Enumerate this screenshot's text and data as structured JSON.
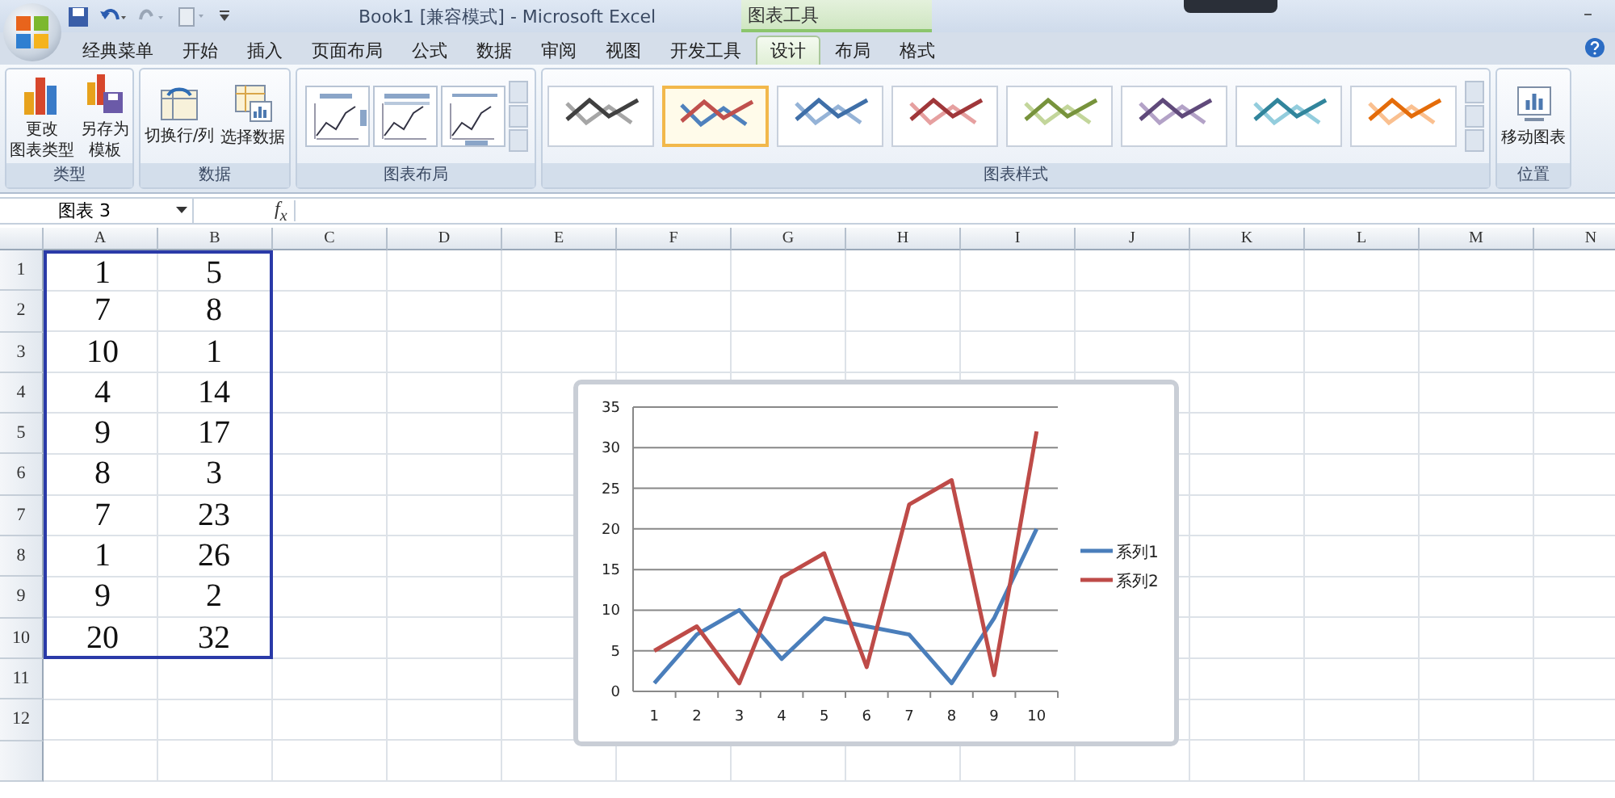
{
  "title_bar": {
    "title": "Book1  [兼容模式] - Microsoft Excel",
    "context_group": "图表工具",
    "minimize": "–"
  },
  "ribbon_tabs": [
    {
      "label": "经典菜单",
      "selected": false
    },
    {
      "label": "开始",
      "selected": false
    },
    {
      "label": "插入",
      "selected": false
    },
    {
      "label": "页面布局",
      "selected": false
    },
    {
      "label": "公式",
      "selected": false
    },
    {
      "label": "数据",
      "selected": false
    },
    {
      "label": "审阅",
      "selected": false
    },
    {
      "label": "视图",
      "selected": false
    },
    {
      "label": "开发工具",
      "selected": false
    },
    {
      "label": "设计",
      "selected": true
    },
    {
      "label": "布局",
      "selected": false
    },
    {
      "label": "格式",
      "selected": false
    }
  ],
  "ribbon_groups": [
    {
      "kind": "buttons",
      "label": "类型",
      "buttons": [
        {
          "lines": [
            "更改",
            "图表类型"
          ]
        },
        {
          "lines": [
            "另存为",
            "模板"
          ]
        }
      ]
    },
    {
      "kind": "buttons",
      "label": "数据",
      "buttons": [
        {
          "lines": [
            "切换行/列"
          ]
        },
        {
          "lines": [
            "选择数据"
          ]
        }
      ]
    },
    {
      "kind": "layouts",
      "label": "图表布局",
      "layouts": [
        {
          "kind": "legend-right"
        },
        {
          "kind": "title-top"
        },
        {
          "kind": "axis-titles"
        }
      ]
    },
    {
      "kind": "styles",
      "label": "图表样式",
      "styles": [
        {
          "lines": [
            {
              "color": "#404040"
            },
            {
              "color": "#a6a6a6"
            }
          ],
          "selected": false
        },
        {
          "lines": [
            {
              "color": "#c0504d"
            },
            {
              "color": "#4f81bd"
            }
          ],
          "selected": true
        },
        {
          "lines": [
            {
              "color": "#3f6fa8"
            },
            {
              "color": "#95b3d7"
            }
          ],
          "selected": false
        },
        {
          "lines": [
            {
              "color": "#a0373a"
            },
            {
              "color": "#e6a0a0"
            }
          ],
          "selected": false
        },
        {
          "lines": [
            {
              "color": "#77933c"
            },
            {
              "color": "#c3d69b"
            }
          ],
          "selected": false
        },
        {
          "lines": [
            {
              "color": "#604a7b"
            },
            {
              "color": "#b3a2c7"
            }
          ],
          "selected": false
        },
        {
          "lines": [
            {
              "color": "#31859c"
            },
            {
              "color": "#93cddd"
            }
          ],
          "selected": false
        },
        {
          "lines": [
            {
              "color": "#e46c0a"
            },
            {
              "color": "#fac090"
            }
          ],
          "selected": false
        }
      ]
    },
    {
      "kind": "buttons",
      "label": "位置",
      "buttons": [
        {
          "lines": [
            "移动图表"
          ]
        }
      ]
    }
  ],
  "formula_bar": {
    "name_box": "图表 3",
    "function_label": "f$_{x}$"
  },
  "sheet": {
    "columns": [
      "A",
      "B",
      "C",
      "D",
      "E",
      "F",
      "G",
      "H",
      "I",
      "J",
      "K",
      "L",
      "M",
      "N"
    ],
    "rows": [
      {
        "header": "1",
        "cells": [
          "1",
          "5"
        ],
        "selected": true
      },
      {
        "header": "2",
        "cells": [
          "7",
          "8"
        ],
        "selected": true
      },
      {
        "header": "3",
        "cells": [
          "10",
          "1"
        ],
        "selected": true
      },
      {
        "header": "4",
        "cells": [
          "4",
          "14"
        ],
        "selected": true
      },
      {
        "header": "5",
        "cells": [
          "9",
          "17"
        ],
        "selected": true
      },
      {
        "header": "6",
        "cells": [
          "8",
          "3"
        ],
        "selected": true
      },
      {
        "header": "7",
        "cells": [
          "7",
          "23"
        ],
        "selected": true
      },
      {
        "header": "8",
        "cells": [
          "1",
          "26"
        ],
        "selected": true
      },
      {
        "header": "9",
        "cells": [
          "9",
          "2"
        ],
        "selected": true
      },
      {
        "header": "10",
        "cells": [
          "20",
          "32"
        ],
        "selected": true
      },
      {
        "header": "11",
        "selected": false
      },
      {
        "header": "12",
        "selected": false
      }
    ]
  },
  "chart": {
    "chart_data": {
      "type": "line",
      "categories": [
        "1",
        "2",
        "3",
        "4",
        "5",
        "6",
        "7",
        "8",
        "9",
        "10"
      ],
      "series": [
        {
          "name": "系列1",
          "color": "#4a7ebb",
          "values": [
            1,
            7,
            10,
            4,
            9,
            8,
            7,
            1,
            9,
            20
          ]
        },
        {
          "name": "系列2",
          "color": "#be4b48",
          "values": [
            5,
            8,
            1,
            14,
            17,
            3,
            23,
            26,
            2,
            32
          ]
        }
      ],
      "ylim": [
        0,
        35
      ],
      "yticks": [
        0,
        5,
        10,
        15,
        20,
        25,
        30,
        35
      ],
      "grid": true,
      "legend": true
    }
  }
}
